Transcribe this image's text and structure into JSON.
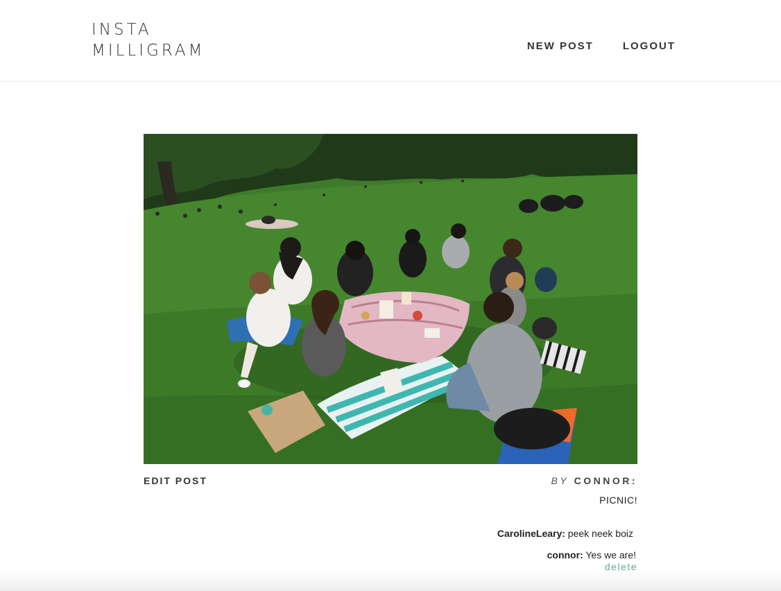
{
  "header": {
    "logo_line1": "INSTA",
    "logo_line2": "MILLIGRAM",
    "nav": {
      "new_post": "NEW POST",
      "logout": "LOGOUT"
    }
  },
  "post": {
    "edit_label": "EDIT POST",
    "by_label": "BY",
    "author": "CONNOR:",
    "caption": "PICNIC!",
    "comments": [
      {
        "user": "CarolineLeary:",
        "text": " peek neek boiz"
      },
      {
        "user": "connor:",
        "text": " Yes we are!"
      }
    ],
    "delete_label": "delete"
  },
  "colors": {
    "accent_delete": "#5cab8f",
    "grass": "#3f7a2c",
    "text": "#333333"
  }
}
